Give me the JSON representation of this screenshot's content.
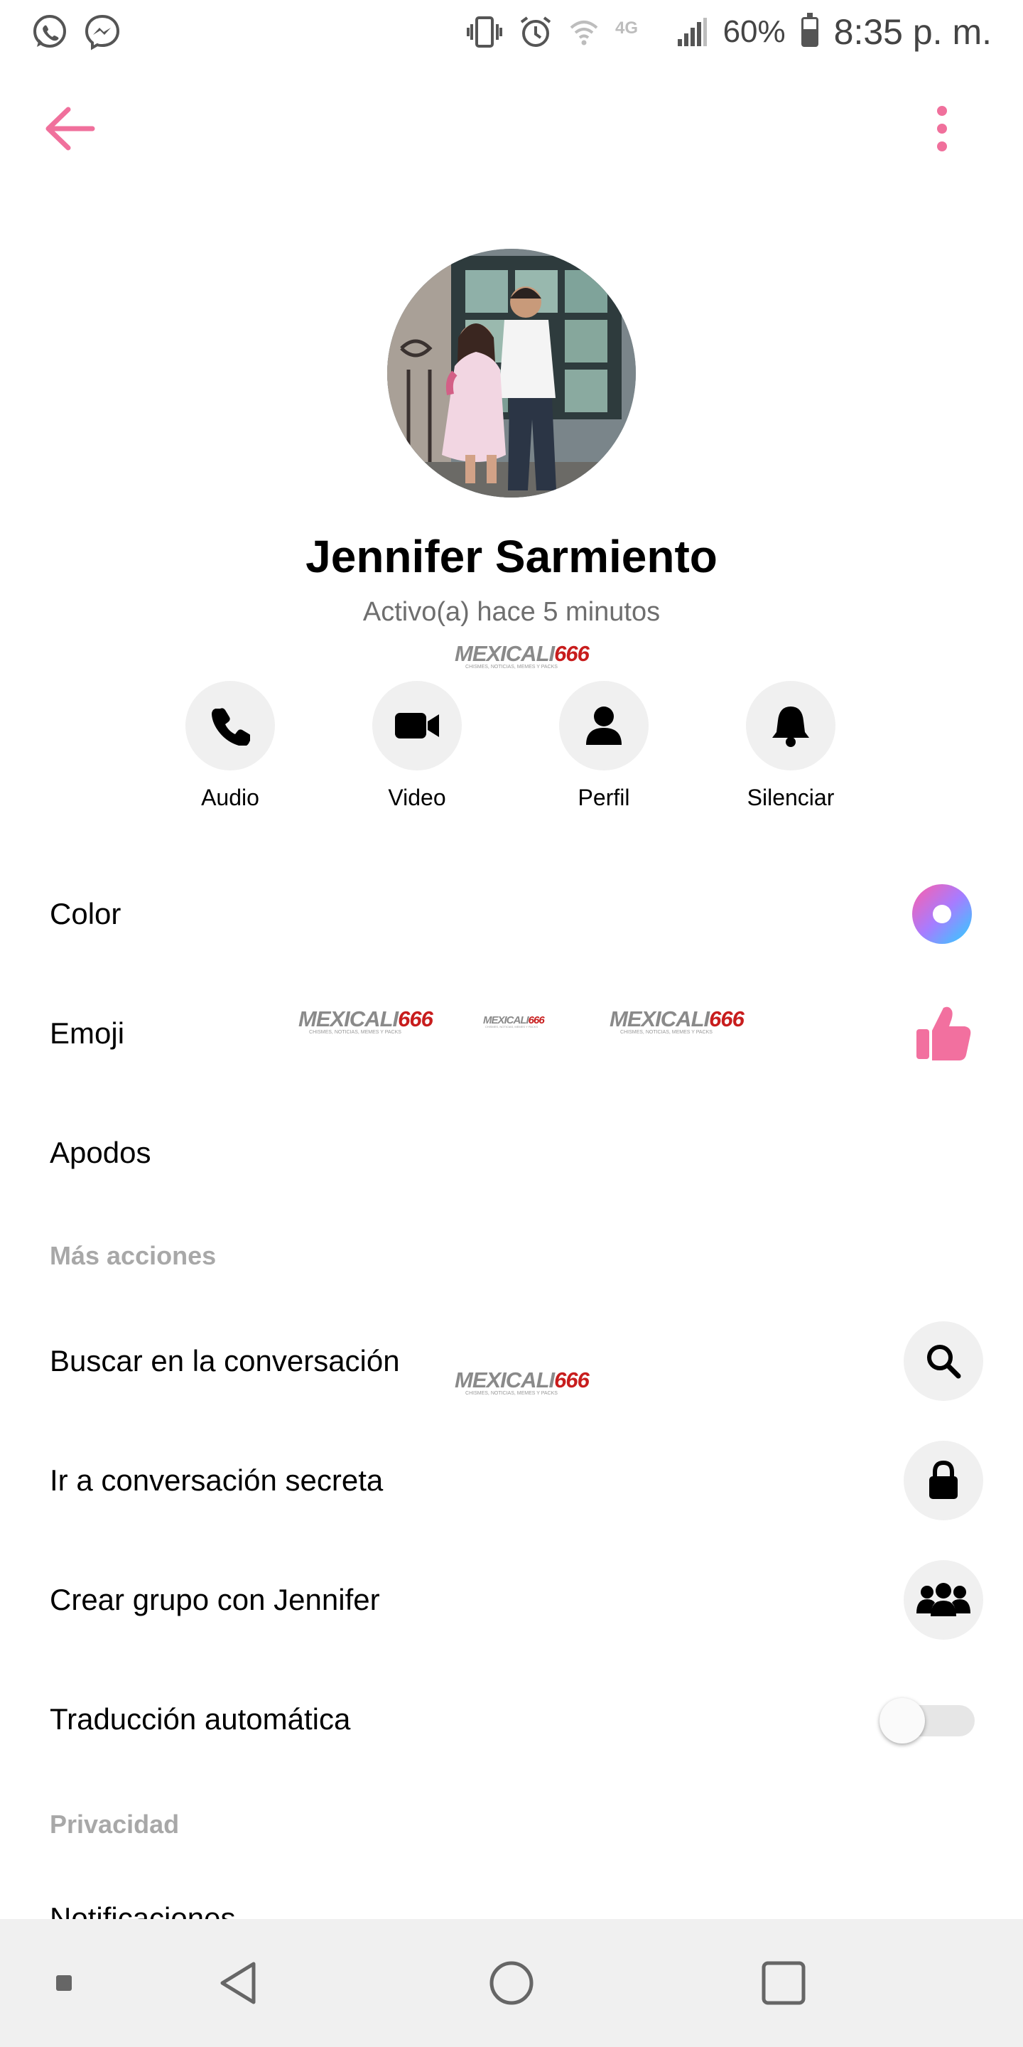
{
  "status_bar": {
    "battery_text": "60%",
    "battery_level": 0.6,
    "network_label": "4G",
    "time": "8:35 p. m.",
    "notification_icons": [
      "whatsapp-icon",
      "messenger-icon"
    ],
    "system_icons": [
      "vibrate-icon",
      "alarm-icon",
      "wifi-icon",
      "network-4g-icon",
      "signal-icon",
      "battery-icon"
    ]
  },
  "header": {
    "back_icon": "arrow-left-icon",
    "menu_icon": "more-vertical-icon"
  },
  "profile": {
    "name": "Jennifer Sarmiento",
    "status": "Activo(a) hace 5 minutos"
  },
  "watermark": {
    "brand_a": "MEXICALI",
    "brand_b": "666",
    "tagline": "CHISMES, NOTICIAS, MEMES Y PACKS"
  },
  "actions": [
    {
      "label": "Audio",
      "icon": "phone-icon"
    },
    {
      "label": "Video",
      "icon": "video-camera-icon"
    },
    {
      "label": "Perfil",
      "icon": "person-icon"
    },
    {
      "label": "Silenciar",
      "icon": "bell-icon"
    }
  ],
  "settings": {
    "color_label": "Color",
    "emoji_label": "Emoji",
    "nicknames_label": "Apodos"
  },
  "more_actions": {
    "header": "Más acciones",
    "search_label": "Buscar en la conversación",
    "secret_label": "Ir a conversación secreta",
    "group_label": "Crear grupo con Jennifer",
    "translate_label": "Traducción automática",
    "translate_enabled": false
  },
  "privacy": {
    "header": "Privacidad",
    "notifications_label": "Notificaciones"
  },
  "colors": {
    "accent": "#f0709c",
    "like": "#f2709f",
    "section_header": "#a8a8a8",
    "icon_bg": "#f0f0f0",
    "watermark_red": "#c81d1d"
  }
}
